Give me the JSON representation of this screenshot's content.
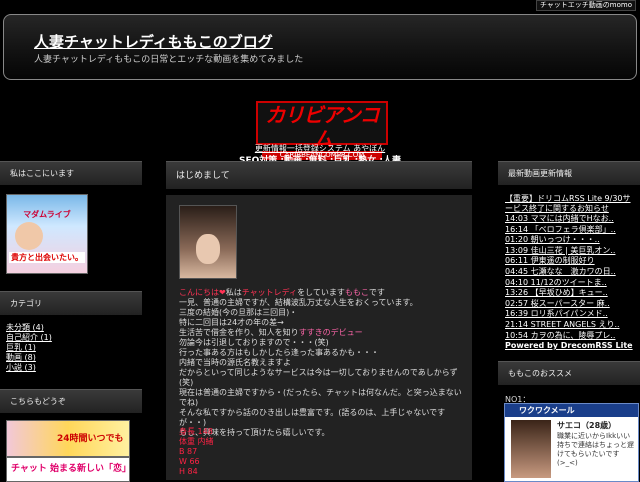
{
  "top_link": "チャットエッチ動画のmomo",
  "header": {
    "title": "人妻チャットレディももこのブログ",
    "description": "人妻チャットレディももこの日常とエッチな動画を集めてみました"
  },
  "center_ad": {
    "logo": "カリビアンコム",
    "sub": "CARIBBEANCOMPR.COM",
    "line1": "更新情報一括登録システム あやぼん",
    "line2": "SEO対策 :動画 :無料 :巨乳 :熟女 :人妻"
  },
  "left_sidebar": {
    "profile_heading": "私はここにいます",
    "banner_title": "マダムライブ",
    "banner_text": "貴方と出会いたい。",
    "category_heading": "カテゴリ",
    "categories": [
      "未分類 (4)",
      "自己紹介 (1)",
      "巨乳 (1)",
      "動画 (8)",
      "小説 (3)"
    ],
    "recommend_heading": "こちらもどうぞ",
    "ad1_text": "24時間いつでも",
    "ad2_text": "チャット 始まる新しい「恋」"
  },
  "post": {
    "heading": "はじめまして",
    "greeting": "こんにちは",
    "chatlady": "チャットレディ",
    "momoko": "ももこ",
    "lines": [
      "一見、普通の主婦ですが、結構波乱万丈な人生をおくっています。",
      "三度の結婚(今の旦那は三回目)・",
      "特に二回目は24才の年の差→",
      "生活苦で借金を作り、知人を知り",
      "勿論今は引退しておりますので・・・(笑)",
      "行った事ある方はもしかしたら逢った事あるかも・・・",
      "内緒で当時の源氏名教えますよ",
      "だからといって同じようなサービスは今は一切しておりませんのであしからず(笑)",
      "現在は普通の主婦ですから・(だったら、チャットは何なんだ。と突っ込まないでね)",
      "そんな私ですから話のひき出しは豊富です。(語るのは、上手じゃないですが・・)",
      "もし、興味を持って頂けたら嬉しいです。"
    ],
    "intro_prefix": "私は",
    "intro_mid": "をしています",
    "intro_suffix": "です",
    "debut_text": "すすきのデビュー",
    "stats": [
      "身長  148",
      "体重  内緒",
      "B 87",
      "W 66",
      "H 84"
    ]
  },
  "right_sidebar": {
    "rss_heading": "最新動画更新情報",
    "rss_items": [
      "【重要】ドリコムRSS Lite 9/30サービス終了に関するお知らせ",
      "14:03 ママには内緒でHなお..",
      "16:14 「ベロフェラ倶楽部」..",
      "01:20 朝いっつけ・・・..",
      "13:09 佳山三花 | 美巨乳オン..",
      "06:11 伊東遥の制服好り",
      "04:45 七瀬なな　激カワの日..",
      "04:10 11/12のツイートま..",
      "13:26 【早坂ひめ】キュー..",
      "02:57 桜スーパースター 麻..",
      "16:39 ロリ系パイパンメド..",
      "21:14 STREET ANGELS えり..",
      "10:54 カヲの為に、陵辱プレ.."
    ],
    "rss_powered": "Powered by DrecomRSS Lite",
    "recommend_heading": "ももこのおススメ",
    "no1": "NO1：",
    "ad_title": "ワクワクメール",
    "ad_name": "サエコ（28歳）",
    "ad_text": "職業に近いからIkkいい持ちで連絡はちょっと遅けてもらいたいです(>_<)"
  }
}
